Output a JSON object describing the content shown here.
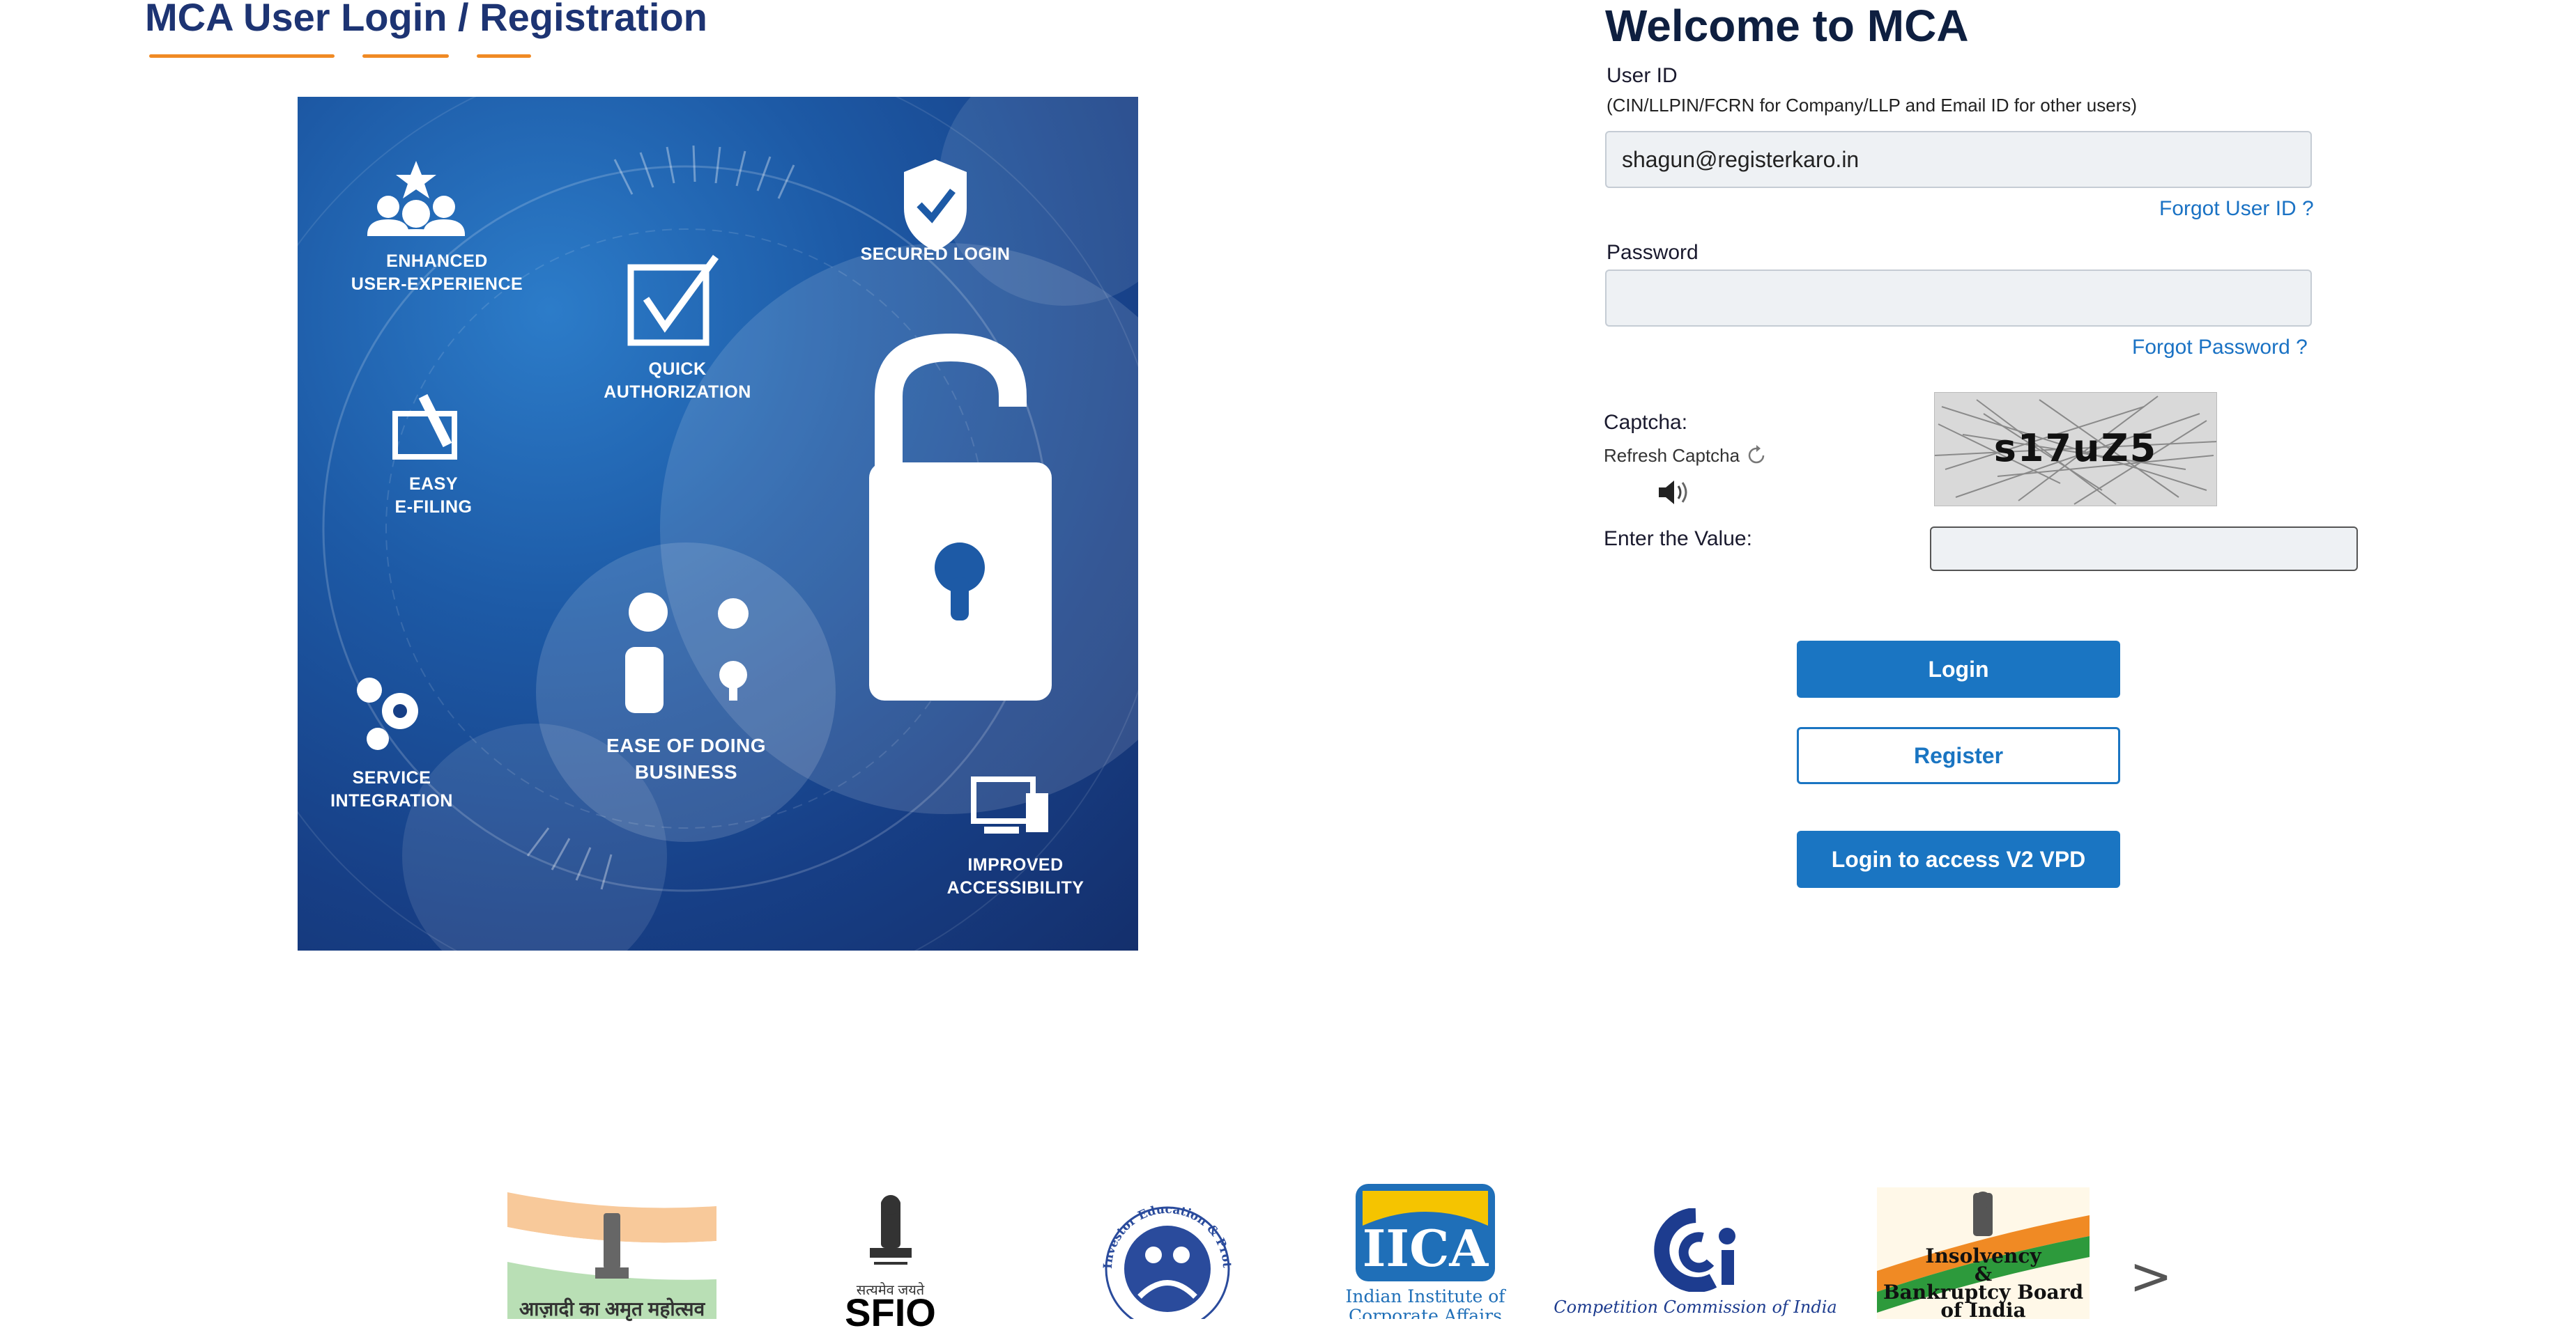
{
  "left": {
    "title": "MCA User Login / Registration",
    "hero_labels": {
      "enhanced": [
        "ENHANCED",
        "USER-EXPERIENCE"
      ],
      "secured": "SECURED LOGIN",
      "quick": [
        "QUICK",
        "AUTHORIZATION"
      ],
      "efiling": [
        "EASY",
        "E-FILING"
      ],
      "ease": [
        "EASE OF DOING",
        "BUSINESS"
      ],
      "service": [
        "SERVICE",
        "INTEGRATION"
      ],
      "access": [
        "IMPROVED",
        "ACCESSIBILITY"
      ]
    }
  },
  "login": {
    "welcome": "Welcome to MCA",
    "userid_label": "User ID",
    "userid_hint": "(CIN/LLPIN/FCRN for Company/LLP and Email ID for other users)",
    "userid_value": "shagun@registerkaro.in",
    "forgot_userid": "Forgot User ID ?",
    "password_label": "Password",
    "password_value": "",
    "forgot_password": "Forgot Password ?",
    "captcha_label": "Captcha:",
    "refresh_captcha": "Refresh Captcha",
    "captcha_code": "s17uZ5",
    "enter_value_label": "Enter the Value:",
    "captcha_value": "",
    "login_button": "Login",
    "register_button": "Register",
    "v2_button": "Login to access V2 VPD"
  },
  "footer": {
    "logos": {
      "azadi": "आज़ादी का अमृत महोत्सव",
      "sfio": "SFIO",
      "iepfa_arc": "Investor Education & Protection Fund Authority",
      "iica": "IICA",
      "iica_sub": "Indian Institute of Corporate Affairs",
      "cci": "Competition Commission of India",
      "ibbi": [
        "Insolvency",
        "&",
        "Bankruptcy Board",
        "of India"
      ],
      "emblem_motto": "सत्यमेव जयते"
    },
    "next_arrow": ">"
  },
  "colors": {
    "navy": "#1d3473",
    "accent_orange": "#f08a24",
    "primary_blue": "#1a75c2",
    "link_blue": "#1a72c4"
  }
}
